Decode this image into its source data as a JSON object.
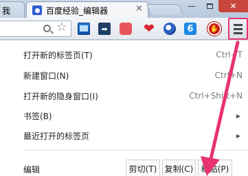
{
  "tabs": [
    {
      "title": "我"
    },
    {
      "title": "百度经验_编辑器",
      "close": "×"
    }
  ],
  "window_controls": {
    "minimize": "—",
    "close": "✕"
  },
  "toolbar": {
    "star": "☆",
    "extensions": [
      {
        "name": "screen-capture"
      },
      {
        "name": "forward-arrow",
        "glyph": "➡"
      },
      {
        "name": "pinterest-like"
      },
      {
        "name": "heart",
        "glyph": "❤"
      },
      {
        "name": "globe"
      },
      {
        "name": "shield-6",
        "glyph": "6"
      },
      {
        "name": "stop-hand",
        "glyph": "✋"
      }
    ]
  },
  "menu": {
    "items": [
      {
        "label": "打开新的标签页(T)",
        "shortcut": "Ctrl+T"
      },
      {
        "label": "新建窗口(N)",
        "shortcut": "Ctrl+N"
      },
      {
        "label": "打开新的隐身窗口(I)",
        "shortcut": "Ctrl+Shift+N"
      },
      {
        "label": "书签(B)",
        "arrow": "▶"
      },
      {
        "label": "最近打开的标签页",
        "arrow": "▶"
      }
    ],
    "edit": {
      "label": "编辑",
      "cut": "剪切(T)",
      "copy": "复制(C)",
      "paste": "粘贴(P)"
    }
  },
  "colors": {
    "highlight": "#e8336f",
    "arrow": "#e8336f"
  }
}
